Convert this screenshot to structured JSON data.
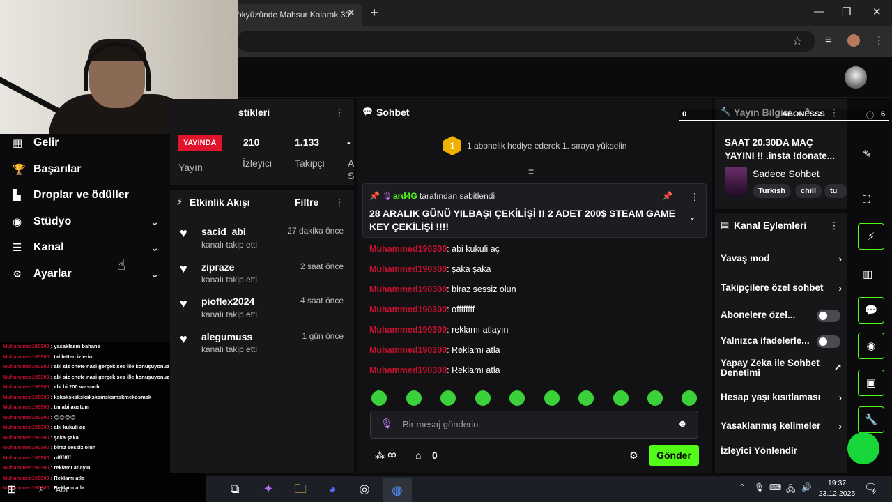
{
  "browser": {
    "tab_title": "ökyüzünde Mahsur Kalarak 30",
    "tab_close": "✕",
    "new_tab": "+",
    "window_controls": [
      "—",
      "❐",
      "✕"
    ]
  },
  "sidebar": {
    "items": [
      {
        "label": "Gelir",
        "icon": "revenue-icon",
        "glyph": "▦"
      },
      {
        "label": "Başarılar",
        "icon": "trophy-icon",
        "glyph": "🏆"
      },
      {
        "label": "Droplar ve ödüller",
        "icon": "drops-icon",
        "glyph": "▙"
      },
      {
        "label": "Stüdyo",
        "icon": "studio-icon",
        "glyph": "◉",
        "chevron": "⌄"
      },
      {
        "label": "Kanal",
        "icon": "channel-icon",
        "glyph": "☰",
        "chevron": "⌄"
      },
      {
        "label": "Ayarlar",
        "icon": "settings-icon",
        "glyph": "⚙",
        "chevron": "⌄"
      }
    ]
  },
  "overlay_chat": [
    {
      "user": "Muhammed190300",
      "text": " : yasaklasın bahane"
    },
    {
      "user": "Muhammed190300",
      "text": " : tabletten izlerim"
    },
    {
      "user": "Muhammed190300",
      "text": " : abi siz chete nasi gerçek ses ille konuşuyonuz"
    },
    {
      "user": "Muhammed190300",
      "text": " : abi siz chete nasi gerçek ses ille konuşuyonuz"
    },
    {
      "user": "Muhammed190300",
      "text": " : abi bi 200 varsındır"
    },
    {
      "user": "Muhammed190300",
      "text": " : ksksksksksksksksmsksmskmekosmsk"
    },
    {
      "user": "Muhammed190300",
      "text": " : tm abi austum"
    },
    {
      "user": "Muhammed190300",
      "text": " : 😊😊😊😊"
    },
    {
      "user": "Muhammed190300",
      "text": " : abi kukuli aç"
    },
    {
      "user": "Muhammed190300",
      "text": " : şaka şaka"
    },
    {
      "user": "Muhammed190300",
      "text": " : biraz sessiz olun"
    },
    {
      "user": "Muhammed190300",
      "text": " : offffffff"
    },
    {
      "user": "Muhammed190300",
      "text": " : reklamı atlayın"
    },
    {
      "user": "Muhammed190300",
      "text": " : Reklamı atla"
    },
    {
      "user": "Muhammed190300",
      "text": " : Reklamı atla"
    }
  ],
  "stats": {
    "title": "stikleri",
    "live_badge": "YAYINDA",
    "live_label": "Yayın",
    "viewers_value": "210",
    "viewers_label": "İzleyici",
    "followers_value": "1.133",
    "followers_label": "Takipçi",
    "extra_value": "-",
    "extra_label_1": "A",
    "extra_label_2": "S"
  },
  "activity": {
    "title": "Etkinlik Akışı",
    "filter": "Filtre",
    "items": [
      {
        "name": "sacid_abi",
        "sub": "kanalı takip etti",
        "time": "27 dakika önce"
      },
      {
        "name": "zipraze",
        "sub": "kanalı takip etti",
        "time": "2 saat önce"
      },
      {
        "name": "pioflex2024",
        "sub": "kanalı takip etti",
        "time": "4 saat önce"
      },
      {
        "name": "alegumuss",
        "sub": "kanalı takip etti",
        "time": "1 gün önce"
      }
    ]
  },
  "chat": {
    "title": "Sohbet",
    "gift_rank": "1",
    "gift_text": "1 abonelik hediye ederek 1. sıraya yükselin",
    "pinned_by_user": "ard4G",
    "pinned_by_text": "tarafından sabitlendi",
    "pinned_message": "28 ARALIK GÜNÜ YILBAŞI ÇEKİLİŞİ !! 2 ADET 200$ STEAM GAME KEY ÇEKİLİŞİ !!!!",
    "messages": [
      {
        "user": "Muhammed190300",
        "text": ": abi kukuli aç"
      },
      {
        "user": "Muhammed190300",
        "text": ": şaka şaka"
      },
      {
        "user": "Muhammed190300",
        "text": ": biraz sessiz olun"
      },
      {
        "user": "Muhammed190300",
        "text": ": offffffff"
      },
      {
        "user": "Muhammed190300",
        "text": ": reklamı atlayın"
      },
      {
        "user": "Muhammed190300",
        "text": ": Reklamı atla"
      },
      {
        "user": "Muhammed190300",
        "text": ": Reklamı atla"
      }
    ],
    "input_placeholder": "Bir mesaj gönderin",
    "infinity": "∞",
    "store_count": "0",
    "send_label": "Gönder"
  },
  "stream_info": {
    "title": "Yayın Bilgisi",
    "stream_title": "SAAT 20.30DA MAÇ YAYINI !! .insta !donate...",
    "category": "Sadece Sohbet",
    "tags": [
      "Turkish",
      "chill",
      "tu"
    ]
  },
  "overlay_bar": {
    "left_count": "0",
    "name": "ABONESSS",
    "right_count": "6"
  },
  "channel_actions": {
    "title": "Kanal Eylemleri",
    "rows": [
      {
        "label": "Yavaş mod",
        "kind": "chevron"
      },
      {
        "label": "Takipçilere özel sohbet",
        "kind": "chevron"
      },
      {
        "label": "Abonelere özel...",
        "kind": "toggle"
      },
      {
        "label": "Yalnızca ifadelerle...",
        "kind": "toggle"
      },
      {
        "label": "Yapay Zeka ile Sohbet Denetimi",
        "kind": "external"
      },
      {
        "label": "Hesap yaşı kısıtlaması",
        "kind": "chevron"
      },
      {
        "label": "Yasaklanmış kelimeler",
        "kind": "chevron"
      },
      {
        "label": "İzleyici Yönlendir",
        "kind": "none"
      }
    ],
    "chevron_glyph": "›",
    "external_glyph": "↗"
  },
  "taskbar": {
    "search_label": "Ara",
    "time": "19:37",
    "date": "23.12.2025",
    "notification_count": "2"
  },
  "colors": {
    "brand_green": "#53fc18",
    "live_red": "#e0142c",
    "username_red": "#c8102e",
    "panel_bg": "#17171a",
    "page_bg": "#0b0b0d"
  }
}
